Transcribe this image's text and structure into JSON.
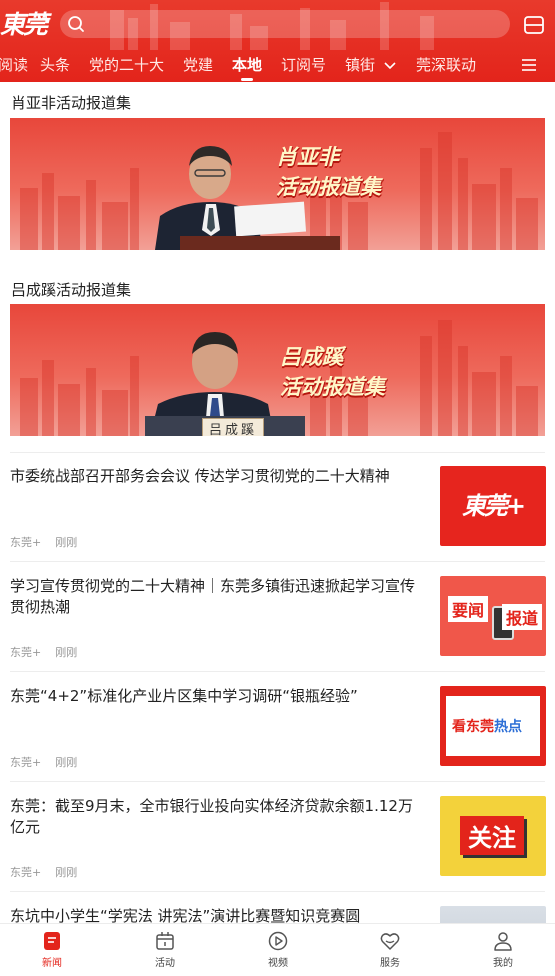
{
  "header": {
    "logo_text": "東莞",
    "logo_plus": "+",
    "tabs": [
      "阅读",
      "头条",
      "党的二十大",
      "党建",
      "本地",
      "订阅号",
      "镇街",
      "莞深联动"
    ],
    "active_tab": "本地"
  },
  "specials": [
    {
      "title": "肖亚非活动报道集",
      "banner_line1": "肖亚非",
      "banner_line2": "活动报道集"
    },
    {
      "title": "吕成蹊活动报道集",
      "banner_line1": "吕成蹊",
      "banner_line2": "活动报道集",
      "nameplate": "吕成蹊"
    }
  ],
  "news": [
    {
      "title": "市委统战部召开部务会会议 传达学习贯彻党的二十大精神",
      "source": "东莞+",
      "time": "刚刚",
      "thumb_text": "東莞+"
    },
    {
      "title": "学习宣传贯彻党的二十大精神｜东莞多镇街迅速掀起学习宣传贯彻热潮",
      "source": "东莞+",
      "time": "刚刚",
      "thumb_text_a": "要闻",
      "thumb_text_b": "报道"
    },
    {
      "title": "东莞“4+2”标准化产业片区集中学习调研“银瓶经验”",
      "source": "东莞+",
      "time": "刚刚",
      "thumb_text_a": "看东莞",
      "thumb_text_b": "热点"
    },
    {
      "title": "东莞：截至9月末，全市银行业投向实体经济贷款余额1.12万亿元",
      "source": "东莞+",
      "time": "刚刚",
      "thumb_text": "关注"
    },
    {
      "title": "东坑中小学生“学宪法 讲宪法”演讲比赛暨知识竞赛圆",
      "source": "",
      "time": ""
    }
  ],
  "bottom_nav": [
    {
      "label": "新闻",
      "icon": "news-icon",
      "active": true
    },
    {
      "label": "活动",
      "icon": "activity-icon",
      "active": false
    },
    {
      "label": "视频",
      "icon": "video-icon",
      "active": false
    },
    {
      "label": "服务",
      "icon": "service-icon",
      "active": false
    },
    {
      "label": "我的",
      "icon": "profile-icon",
      "active": false
    }
  ],
  "colors": {
    "brand": "#e3241b",
    "active_nav": "#e3241b"
  }
}
